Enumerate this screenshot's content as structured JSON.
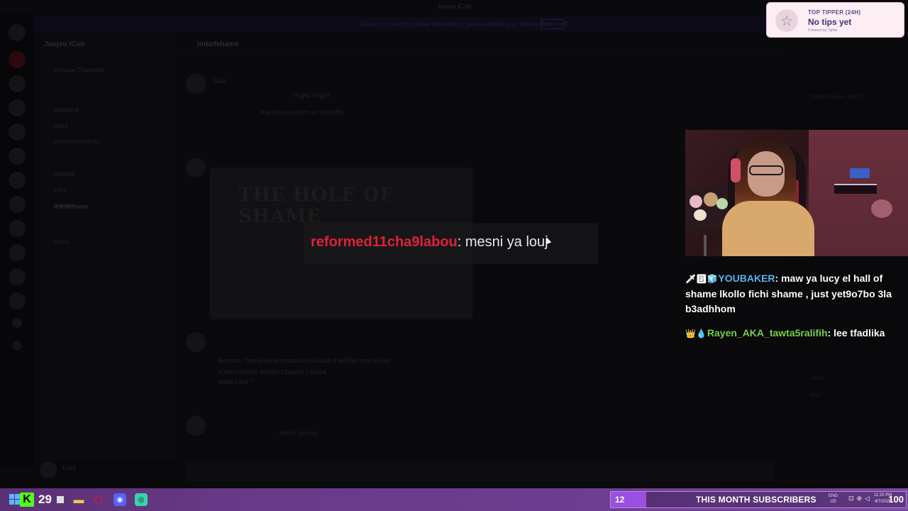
{
  "discord": {
    "window_title": "Joujou ICub",
    "banner_text": "Discord is having trouble connecting, please check your connection.",
    "banner_button": "Reconnect",
    "server_name": "Joujou ICub",
    "channel_header": "lmkofshame",
    "channels": [
      {
        "label": "Browse Channels"
      },
      {
        "label": "welcome"
      },
      {
        "label": "rules"
      },
      {
        "label": "announcements"
      },
      {
        "label": "general"
      },
      {
        "label": "clips"
      },
      {
        "label": "memes"
      },
      {
        "label": "lmkofshame"
      },
      {
        "label": "voice"
      }
    ],
    "user_name": "Lucy",
    "messages": [
      {
        "author": "Jace",
        "text": "is gay alright"
      },
      {
        "author": "",
        "text": "ena lazim nemchi w nchoufha"
      },
      {
        "author": "",
        "text": "Ernesto: Taw Ennasa maandich Gh3adr fi no50ut ama se3ati t7okmi tcrechi teksilni z3aama 7asasa"
      },
      {
        "author": "",
        "text": "walla bard ?"
      },
      {
        "author": "",
        "text": "mesni ya louj"
      }
    ],
    "embed_title": "THE HOLE OF SHAME",
    "members": [
      "Dr3sh Tnatam BBCB",
      "kaiser",
      "aziz"
    ]
  },
  "alert": {
    "username": "reformed11cha9labou",
    "separator": ":",
    "message": " mesni ya louj"
  },
  "tipper": {
    "title": "TOP TIPPER (24H)",
    "value": "No tips yet",
    "powered_by": "Powered by TipMe",
    "icon": "star-icon"
  },
  "chat": [
    {
      "badges": "🗡🅱🧊",
      "username": "YOUBAKER",
      "username_color": "#5ab4f0",
      "message": " maw ya lucy el hall of shame lkollo fichi shame , just yet9o7bo 3la b3adhhom"
    },
    {
      "badges": "👑💧",
      "username": "Rayen_AKA_tawta5ralifih",
      "username_color": "#76d24a",
      "message": " lee tfadlika"
    }
  ],
  "taskbar": {
    "viewer_count": "29",
    "sub_goal": {
      "current": "12",
      "label": "THIS MONTH SUBSCRIBERS",
      "target": "100",
      "progress_fraction": 0.12
    },
    "lang_top": "ENG",
    "lang_bottom": "US",
    "time": "11:20 PM",
    "date": "4/7/2025"
  }
}
